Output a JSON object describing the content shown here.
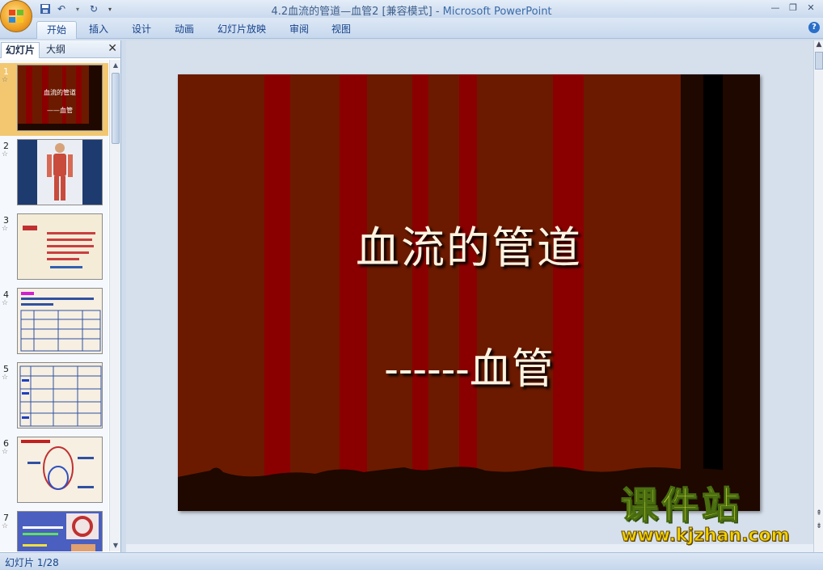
{
  "window": {
    "title": "4.2血流的管道—血管2 [兼容模式]",
    "separator": " - ",
    "app_name": "Microsoft PowerPoint"
  },
  "quick_access": {
    "icons": [
      "save-icon",
      "undo-icon",
      "redo-icon",
      "customize-icon"
    ]
  },
  "ribbon": {
    "tabs": [
      "开始",
      "插入",
      "设计",
      "动画",
      "幻灯片放映",
      "审阅",
      "视图"
    ],
    "active_tab": "开始"
  },
  "left_panel": {
    "tabs": [
      "幻灯片",
      "大纲"
    ],
    "active_tab": "幻灯片",
    "close_label": "✕",
    "thumbnails": [
      {
        "number": "1",
        "title": "血流的管道",
        "subtitle": "——血管"
      },
      {
        "number": "2"
      },
      {
        "number": "3"
      },
      {
        "number": "4"
      },
      {
        "number": "5"
      },
      {
        "number": "6"
      },
      {
        "number": "7"
      }
    ]
  },
  "slide": {
    "title": "血流的管道",
    "subtitle": "------血管",
    "colors": {
      "background": "#6b1a00",
      "stripe_red": "#8a0000",
      "stripe_dark": "#2a0a00",
      "text": "#fff3e0"
    }
  },
  "status_bar": {
    "slide_indicator": "幻灯片 1/28"
  },
  "watermark": {
    "chinese": "课件站",
    "url": "www.kjzhan.com"
  }
}
